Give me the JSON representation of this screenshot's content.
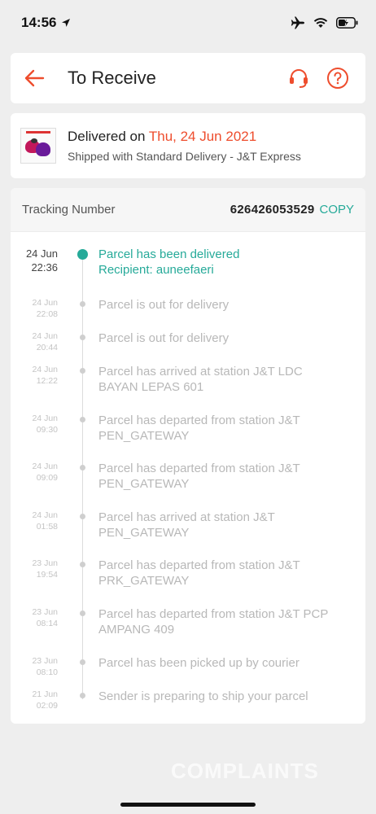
{
  "status_bar": {
    "time": "14:56"
  },
  "header": {
    "title": "To Receive"
  },
  "delivery": {
    "prefix": "Delivered on ",
    "date": "Thu, 24 Jun 2021",
    "shipping": "Shipped with Standard Delivery  - J&T Express"
  },
  "tracking": {
    "label": "Tracking Number",
    "number": "626426053529",
    "copy_label": "COPY"
  },
  "events": [
    {
      "date": "24 Jun",
      "time": "22:36",
      "desc": "Parcel has been delivered",
      "desc2": "Recipient: auneefaeri"
    },
    {
      "date": "24 Jun",
      "time": "22:08",
      "desc": "Parcel is out for delivery"
    },
    {
      "date": "24 Jun",
      "time": "20:44",
      "desc": "Parcel is out for delivery"
    },
    {
      "date": "24 Jun",
      "time": "12:22",
      "desc": "Parcel has arrived at station J&T LDC BAYAN LEPAS 601"
    },
    {
      "date": "24 Jun",
      "time": "09:30",
      "desc": "Parcel has departed from station J&T PEN_GATEWAY"
    },
    {
      "date": "24 Jun",
      "time": "09:09",
      "desc": "Parcel has departed from station J&T PEN_GATEWAY"
    },
    {
      "date": "24 Jun",
      "time": "01:58",
      "desc": "Parcel has arrived at station J&T PEN_GATEWAY"
    },
    {
      "date": "23 Jun",
      "time": "19:54",
      "desc": "Parcel has departed from station J&T PRK_GATEWAY"
    },
    {
      "date": "23 Jun",
      "time": "08:14",
      "desc": "Parcel has departed from station J&T PCP AMPANG 409"
    },
    {
      "date": "23 Jun",
      "time": "08:10",
      "desc": "Parcel has been picked up by courier"
    },
    {
      "date": "21 Jun",
      "time": "02:09",
      "desc": "Sender is preparing to ship your parcel"
    }
  ],
  "watermark": "COMPLAINTS",
  "colors": {
    "accent": "#ee4d2d",
    "teal": "#26aa99"
  },
  "icons": [
    "location-arrow-icon",
    "airplane-icon",
    "wifi-icon",
    "battery-icon",
    "back-arrow-icon",
    "headset-icon",
    "help-icon"
  ]
}
